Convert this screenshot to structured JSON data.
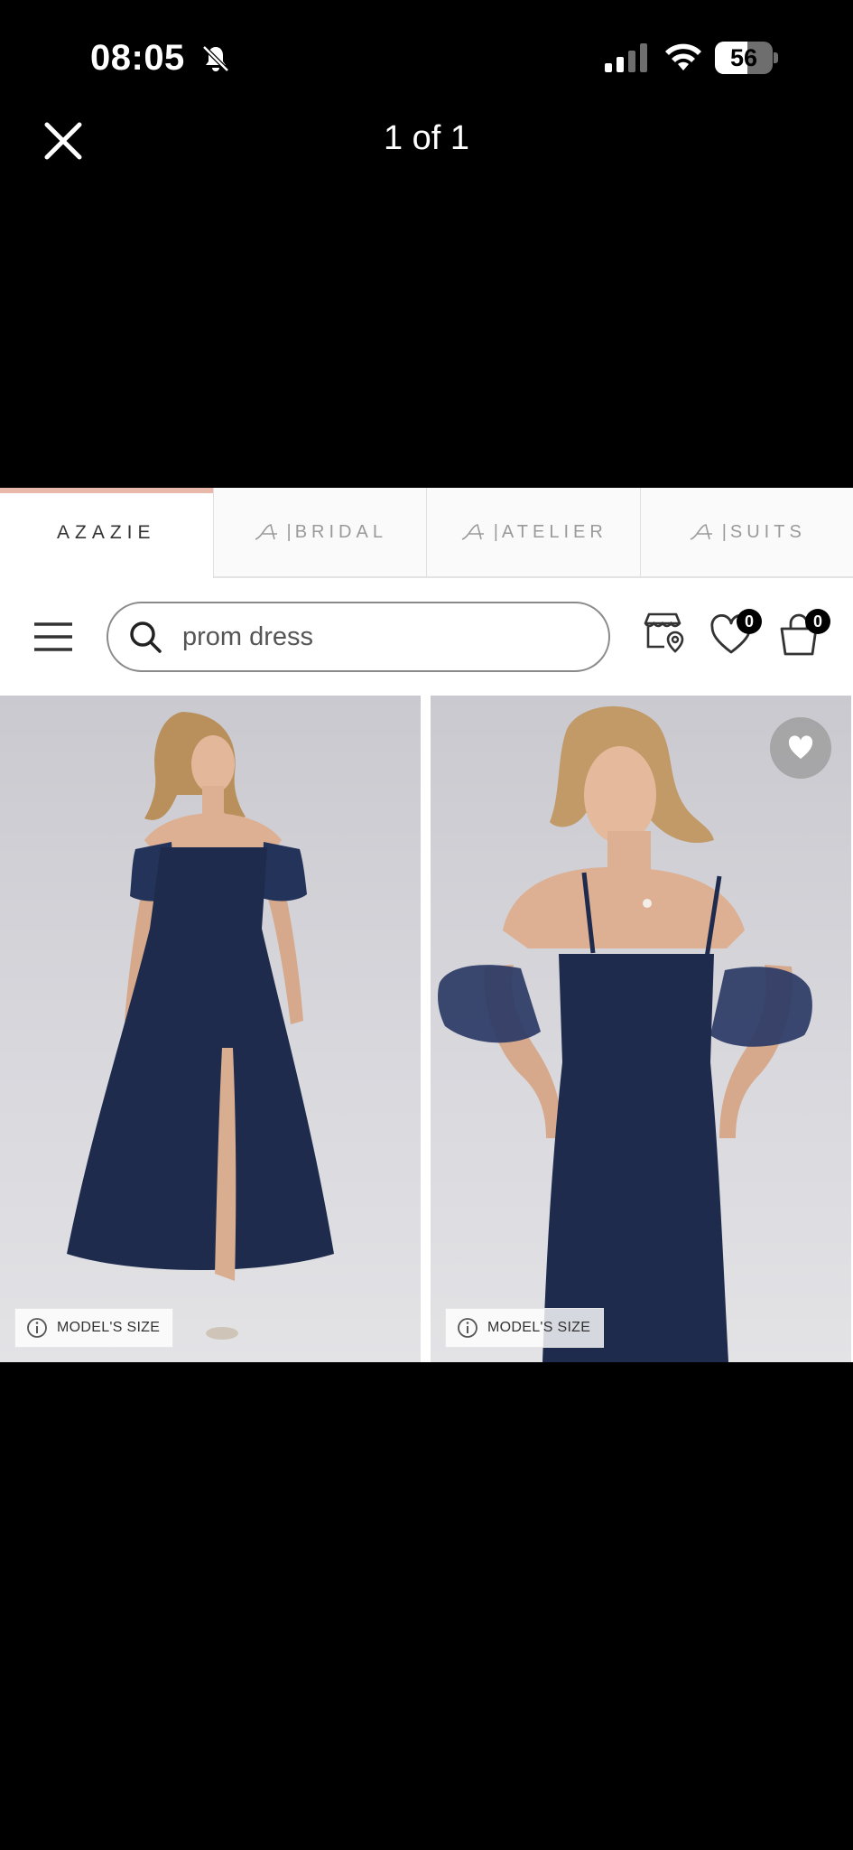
{
  "status_bar": {
    "time": "08:05",
    "battery_percent": "56",
    "icons": [
      "bell-slash-icon",
      "cellular-signal-icon",
      "wifi-icon",
      "battery-icon"
    ]
  },
  "viewer": {
    "counter": "1 of 1",
    "close_icon": "close-icon"
  },
  "brand_tabs": [
    {
      "label": "AZAZIE",
      "active": true
    },
    {
      "label": "BRIDAL",
      "active": false
    },
    {
      "label": "ATELIER",
      "active": false
    },
    {
      "label": "SUITS",
      "active": false
    }
  ],
  "brand_separator": "|",
  "header": {
    "search_value": "prom dress",
    "wishlist_count": "0",
    "bag_count": "0",
    "icons": [
      "menu-icon",
      "search-icon",
      "store-locator-icon",
      "heart-icon",
      "shopping-bag-icon"
    ]
  },
  "products": [
    {
      "model_size_label": "MODEL'S SIZE",
      "dress_color": "#1e2b4d"
    },
    {
      "model_size_label": "MODEL'S SIZE",
      "dress_color": "#1e2b4d"
    }
  ],
  "colors": {
    "accent": "#e8b9ab",
    "dress": "#1e2b4d"
  }
}
